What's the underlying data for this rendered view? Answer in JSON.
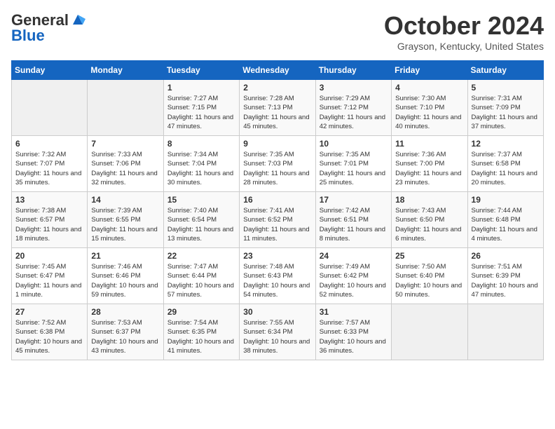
{
  "header": {
    "logo_line1": "General",
    "logo_line2": "Blue",
    "month": "October 2024",
    "location": "Grayson, Kentucky, United States"
  },
  "days_of_week": [
    "Sunday",
    "Monday",
    "Tuesday",
    "Wednesday",
    "Thursday",
    "Friday",
    "Saturday"
  ],
  "weeks": [
    [
      {
        "day": "",
        "info": ""
      },
      {
        "day": "",
        "info": ""
      },
      {
        "day": "1",
        "info": "Sunrise: 7:27 AM\nSunset: 7:15 PM\nDaylight: 11 hours and 47 minutes."
      },
      {
        "day": "2",
        "info": "Sunrise: 7:28 AM\nSunset: 7:13 PM\nDaylight: 11 hours and 45 minutes."
      },
      {
        "day": "3",
        "info": "Sunrise: 7:29 AM\nSunset: 7:12 PM\nDaylight: 11 hours and 42 minutes."
      },
      {
        "day": "4",
        "info": "Sunrise: 7:30 AM\nSunset: 7:10 PM\nDaylight: 11 hours and 40 minutes."
      },
      {
        "day": "5",
        "info": "Sunrise: 7:31 AM\nSunset: 7:09 PM\nDaylight: 11 hours and 37 minutes."
      }
    ],
    [
      {
        "day": "6",
        "info": "Sunrise: 7:32 AM\nSunset: 7:07 PM\nDaylight: 11 hours and 35 minutes."
      },
      {
        "day": "7",
        "info": "Sunrise: 7:33 AM\nSunset: 7:06 PM\nDaylight: 11 hours and 32 minutes."
      },
      {
        "day": "8",
        "info": "Sunrise: 7:34 AM\nSunset: 7:04 PM\nDaylight: 11 hours and 30 minutes."
      },
      {
        "day": "9",
        "info": "Sunrise: 7:35 AM\nSunset: 7:03 PM\nDaylight: 11 hours and 28 minutes."
      },
      {
        "day": "10",
        "info": "Sunrise: 7:35 AM\nSunset: 7:01 PM\nDaylight: 11 hours and 25 minutes."
      },
      {
        "day": "11",
        "info": "Sunrise: 7:36 AM\nSunset: 7:00 PM\nDaylight: 11 hours and 23 minutes."
      },
      {
        "day": "12",
        "info": "Sunrise: 7:37 AM\nSunset: 6:58 PM\nDaylight: 11 hours and 20 minutes."
      }
    ],
    [
      {
        "day": "13",
        "info": "Sunrise: 7:38 AM\nSunset: 6:57 PM\nDaylight: 11 hours and 18 minutes."
      },
      {
        "day": "14",
        "info": "Sunrise: 7:39 AM\nSunset: 6:55 PM\nDaylight: 11 hours and 15 minutes."
      },
      {
        "day": "15",
        "info": "Sunrise: 7:40 AM\nSunset: 6:54 PM\nDaylight: 11 hours and 13 minutes."
      },
      {
        "day": "16",
        "info": "Sunrise: 7:41 AM\nSunset: 6:52 PM\nDaylight: 11 hours and 11 minutes."
      },
      {
        "day": "17",
        "info": "Sunrise: 7:42 AM\nSunset: 6:51 PM\nDaylight: 11 hours and 8 minutes."
      },
      {
        "day": "18",
        "info": "Sunrise: 7:43 AM\nSunset: 6:50 PM\nDaylight: 11 hours and 6 minutes."
      },
      {
        "day": "19",
        "info": "Sunrise: 7:44 AM\nSunset: 6:48 PM\nDaylight: 11 hours and 4 minutes."
      }
    ],
    [
      {
        "day": "20",
        "info": "Sunrise: 7:45 AM\nSunset: 6:47 PM\nDaylight: 11 hours and 1 minute."
      },
      {
        "day": "21",
        "info": "Sunrise: 7:46 AM\nSunset: 6:46 PM\nDaylight: 10 hours and 59 minutes."
      },
      {
        "day": "22",
        "info": "Sunrise: 7:47 AM\nSunset: 6:44 PM\nDaylight: 10 hours and 57 minutes."
      },
      {
        "day": "23",
        "info": "Sunrise: 7:48 AM\nSunset: 6:43 PM\nDaylight: 10 hours and 54 minutes."
      },
      {
        "day": "24",
        "info": "Sunrise: 7:49 AM\nSunset: 6:42 PM\nDaylight: 10 hours and 52 minutes."
      },
      {
        "day": "25",
        "info": "Sunrise: 7:50 AM\nSunset: 6:40 PM\nDaylight: 10 hours and 50 minutes."
      },
      {
        "day": "26",
        "info": "Sunrise: 7:51 AM\nSunset: 6:39 PM\nDaylight: 10 hours and 47 minutes."
      }
    ],
    [
      {
        "day": "27",
        "info": "Sunrise: 7:52 AM\nSunset: 6:38 PM\nDaylight: 10 hours and 45 minutes."
      },
      {
        "day": "28",
        "info": "Sunrise: 7:53 AM\nSunset: 6:37 PM\nDaylight: 10 hours and 43 minutes."
      },
      {
        "day": "29",
        "info": "Sunrise: 7:54 AM\nSunset: 6:35 PM\nDaylight: 10 hours and 41 minutes."
      },
      {
        "day": "30",
        "info": "Sunrise: 7:55 AM\nSunset: 6:34 PM\nDaylight: 10 hours and 38 minutes."
      },
      {
        "day": "31",
        "info": "Sunrise: 7:57 AM\nSunset: 6:33 PM\nDaylight: 10 hours and 36 minutes."
      },
      {
        "day": "",
        "info": ""
      },
      {
        "day": "",
        "info": ""
      }
    ]
  ]
}
